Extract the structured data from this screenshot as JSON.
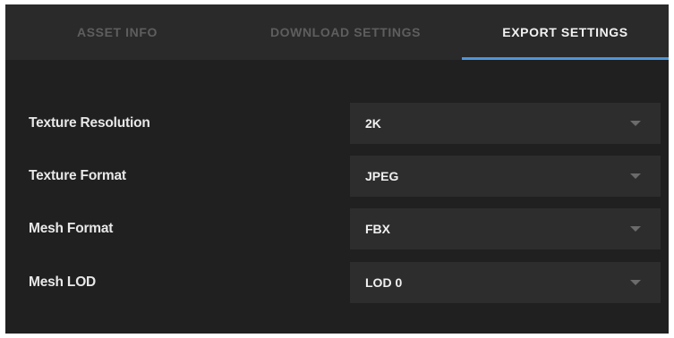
{
  "tabs": [
    {
      "label": "ASSET INFO",
      "active": false
    },
    {
      "label": "DOWNLOAD SETTINGS",
      "active": false
    },
    {
      "label": "EXPORT SETTINGS",
      "active": true
    }
  ],
  "settings": [
    {
      "label": "Texture Resolution",
      "value": "2K"
    },
    {
      "label": "Texture Format",
      "value": "JPEG"
    },
    {
      "label": "Mesh Format",
      "value": "FBX"
    },
    {
      "label": "Mesh LOD",
      "value": "LOD 0"
    }
  ],
  "icons": {
    "dropdown": "caret-down-icon"
  },
  "colors": {
    "panel_background": "#202020",
    "tabbar_background": "#2a2a2a",
    "select_background": "#2d2d2d",
    "active_tab_underline": "#4f95d9",
    "inactive_tab_text": "#5e5e5e",
    "active_tab_text": "#f2f2f2"
  }
}
